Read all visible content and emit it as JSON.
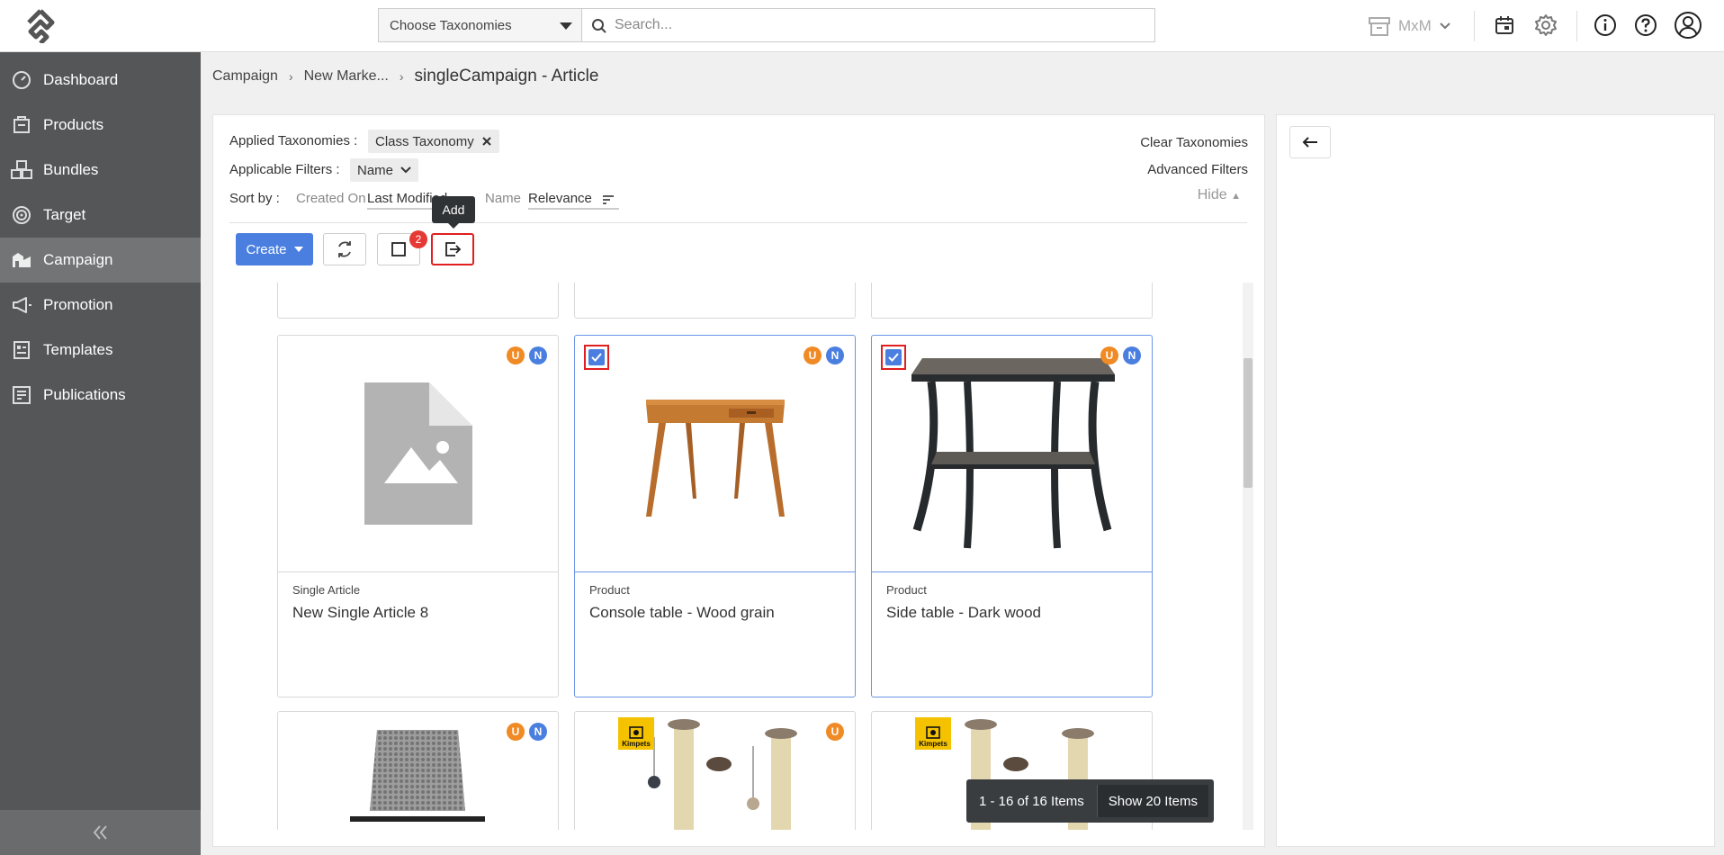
{
  "header": {
    "taxonomy_select": "Choose Taxonomies",
    "search_placeholder": "Search...",
    "workspace": "MxM"
  },
  "sidebar": {
    "items": [
      {
        "label": "Dashboard",
        "icon": "dashboard-icon"
      },
      {
        "label": "Products",
        "icon": "products-icon"
      },
      {
        "label": "Bundles",
        "icon": "bundles-icon"
      },
      {
        "label": "Target",
        "icon": "target-icon"
      },
      {
        "label": "Campaign",
        "icon": "campaign-icon",
        "active": true
      },
      {
        "label": "Promotion",
        "icon": "promotion-icon"
      },
      {
        "label": "Templates",
        "icon": "templates-icon"
      },
      {
        "label": "Publications",
        "icon": "publications-icon"
      }
    ]
  },
  "breadcrumb": {
    "items": [
      "Campaign",
      "New Marke..."
    ],
    "current": "singleCampaign - Article"
  },
  "filters": {
    "applied_label": "Applied Taxonomies :",
    "applied_chip": "Class Taxonomy",
    "applicable_label": "Applicable Filters :",
    "applicable_chip": "Name",
    "sort_label": "Sort by :",
    "sort_options": [
      "Created On",
      "Last Modified",
      "Name",
      "Relevance"
    ],
    "clear": "Clear Taxonomies",
    "advanced": "Advanced Filters",
    "hide": "Hide"
  },
  "toolbar": {
    "create": "Create",
    "selected_count": "2",
    "tooltip": "Add"
  },
  "cards": [
    {
      "type": "Single Article",
      "name": "New Single Article 8",
      "badges": [
        "U",
        "N"
      ],
      "selected": false
    },
    {
      "type": "Product",
      "name": "Console table - Wood grain",
      "badges": [
        "U",
        "N"
      ],
      "selected": true
    },
    {
      "type": "Product",
      "name": "Side table - Dark wood",
      "badges": [
        "U",
        "N"
      ],
      "selected": true
    }
  ],
  "bottom_cards": [
    {
      "badges": [
        "U",
        "N"
      ]
    },
    {
      "badges": [
        "U"
      ],
      "brand": "Kimpets"
    },
    {
      "badges": [],
      "brand": "Kimpets"
    }
  ],
  "pager": {
    "range": "1 - 16 of 16 Items",
    "show": "Show 20 Items"
  },
  "colors": {
    "accent": "#4a7fe0",
    "sidebar": "#555657",
    "badge_u": "#f08a24",
    "badge_n": "#4a7fe0",
    "highlight": "#e02020"
  }
}
